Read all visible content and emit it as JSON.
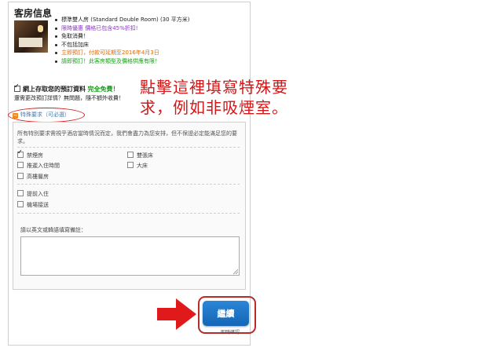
{
  "panel": {
    "title": "客房信息"
  },
  "room": {
    "features": [
      {
        "text": "標準雙人房 (Standard Double Room) (30 平方米)",
        "color": "dark"
      },
      {
        "text": "限時優惠 價格已包含45%折扣!",
        "color": "purple"
      },
      {
        "text": "免取消費！",
        "color": "dark"
      },
      {
        "text": "不包括加床",
        "color": "dark"
      },
      {
        "text": "立即預訂，付款可延期至2016年4月3日",
        "color": "orange"
      },
      {
        "text": "請即預訂！此客房類型及價格供應有限！",
        "color": "green"
      }
    ]
  },
  "save": {
    "label": "網上存取您的預訂資料",
    "free": "完全免費！"
  },
  "question": "還需更改預訂詳情？無問題，隨不額外收費！",
  "special_requests": {
    "link_label": "特殊要求（可必選）",
    "note": "所有特別要求需視乎酒店當時情況而定，我們會盡力為您安排，但不保證必定能滿足您的要求。",
    "options": [
      {
        "label": "禁煙房",
        "checked": true
      },
      {
        "label": "雙張床",
        "checked": false
      },
      {
        "label": "推遲入住時間",
        "checked": false
      },
      {
        "label": "大床",
        "checked": false
      },
      {
        "label": "高樓層房",
        "checked": false
      },
      {
        "label": "提前入住",
        "checked": false
      },
      {
        "label": "機場接送",
        "checked": false
      }
    ],
    "remark_label": "請以英文或韓語填寫備註："
  },
  "annotation": {
    "line1": "點擊這裡填寫特殊要",
    "line2": "求，例如非吸煙室。"
  },
  "actions": {
    "continue_label": "繼續",
    "confirm_note": "即時確認"
  },
  "colors": {
    "accent_red": "#d01818",
    "button_blue": "#1a72c4",
    "link_blue": "#4a7aa8"
  }
}
